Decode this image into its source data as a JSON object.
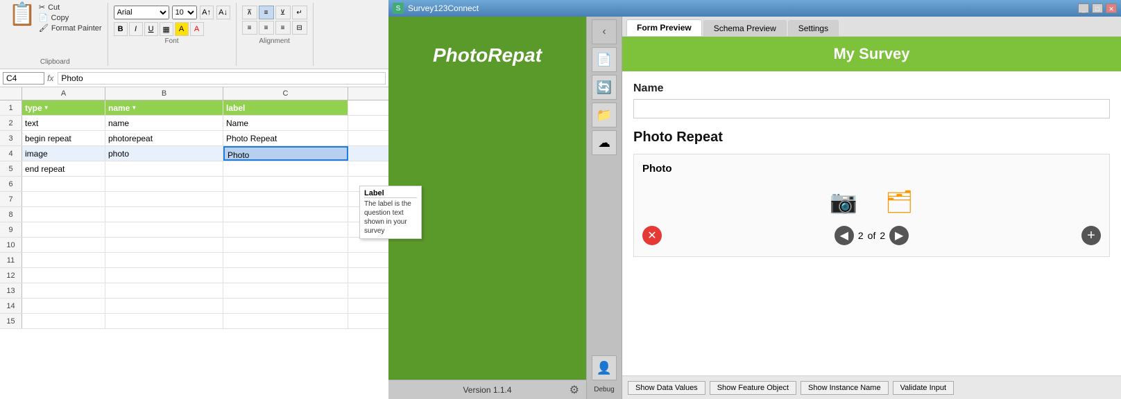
{
  "excel": {
    "toolbar": {
      "paste_label": "Paste",
      "cut_label": "Cut",
      "copy_label": "Copy",
      "format_painter_label": "Format Painter",
      "clipboard_label": "Clipboard",
      "font_name": "Arial",
      "font_size": "10",
      "font_label": "Font",
      "alignment_label": "Alignment"
    },
    "formula_bar": {
      "cell_ref": "C4",
      "formula": "Photo"
    },
    "columns": {
      "a_header": "type",
      "b_header": "name",
      "c_header": "label"
    },
    "rows": [
      {
        "num": "1",
        "a": "type",
        "b": "name",
        "c": "label",
        "is_header": true
      },
      {
        "num": "2",
        "a": "text",
        "b": "name",
        "c": "Name",
        "is_header": false
      },
      {
        "num": "3",
        "a": "begin repeat",
        "b": "photorepeat",
        "c": "Photo Repeat",
        "is_header": false
      },
      {
        "num": "4",
        "a": "image",
        "b": "photo",
        "c": "Photo",
        "is_header": false,
        "selected": true
      },
      {
        "num": "5",
        "a": "end repeat",
        "b": "",
        "c": "",
        "is_header": false
      },
      {
        "num": "6",
        "a": "",
        "b": "",
        "c": ""
      },
      {
        "num": "7",
        "a": "",
        "b": "",
        "c": ""
      },
      {
        "num": "8",
        "a": "",
        "b": "",
        "c": ""
      },
      {
        "num": "9",
        "a": "",
        "b": "",
        "c": ""
      },
      {
        "num": "10",
        "a": "",
        "b": "",
        "c": ""
      },
      {
        "num": "11",
        "a": "",
        "b": "",
        "c": ""
      },
      {
        "num": "12",
        "a": "",
        "b": "",
        "c": ""
      },
      {
        "num": "13",
        "a": "",
        "b": "",
        "c": ""
      },
      {
        "num": "14",
        "a": "",
        "b": "",
        "c": ""
      },
      {
        "num": "15",
        "a": "",
        "b": "",
        "c": ""
      }
    ],
    "tooltip": {
      "title": "Label",
      "text": "The label is the question text shown in your survey"
    }
  },
  "survey_window": {
    "title": "Survey123Connect",
    "left_pane": {
      "app_title": "PhotoRepat"
    },
    "tabs": [
      {
        "label": "Form Preview",
        "active": true
      },
      {
        "label": "Schema Preview",
        "active": false
      },
      {
        "label": "Settings",
        "active": false
      }
    ],
    "form": {
      "header_title": "My Survey",
      "fields": [
        {
          "label": "Name",
          "type": "text"
        }
      ],
      "repeat_section": {
        "title": "Photo Repeat",
        "photo_field_label": "Photo",
        "nav": {
          "current": "2",
          "total": "2",
          "of_text": "of"
        }
      }
    },
    "bottom_bar": {
      "show_data_values": "Show Data Values",
      "show_feature_object": "Show Feature Object",
      "show_instance_name": "Show Instance Name",
      "validate_input": "Validate Input"
    },
    "version_bar": {
      "version": "Version 1.1.4"
    },
    "debug_label": "Debug"
  }
}
